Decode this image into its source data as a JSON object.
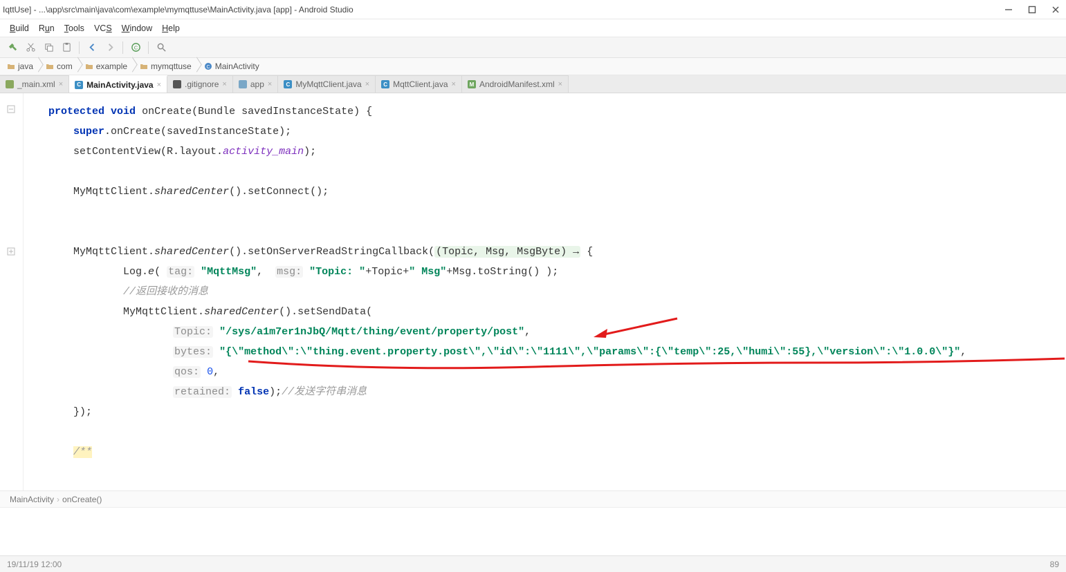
{
  "window": {
    "title": "IqttUse] - ...\\app\\src\\main\\java\\com\\example\\mymqttuse\\MainActivity.java [app] - Android Studio"
  },
  "menu": [
    "Build",
    "Run",
    "Tools",
    "VCS",
    "Window",
    "Help"
  ],
  "breadcrumbs": [
    {
      "icon": "folder",
      "label": "java"
    },
    {
      "icon": "folder",
      "label": "com"
    },
    {
      "icon": "folder",
      "label": "example"
    },
    {
      "icon": "folder",
      "label": "mymqttuse"
    },
    {
      "icon": "class",
      "label": "MainActivity"
    }
  ],
  "tabs": [
    {
      "icon": "xml",
      "label": "_main.xml",
      "active": false
    },
    {
      "icon": "java",
      "label": "MainActivity.java",
      "active": true
    },
    {
      "icon": "git",
      "label": ".gitignore",
      "active": false
    },
    {
      "icon": "grad",
      "label": "app",
      "active": false
    },
    {
      "icon": "java",
      "label": "MyMqttClient.java",
      "active": false
    },
    {
      "icon": "java",
      "label": "MqttClient.java",
      "active": false
    },
    {
      "icon": "mf",
      "label": "AndroidManifest.xml",
      "active": false
    }
  ],
  "code": {
    "sig_kw1": "protected",
    "sig_kw2": "void",
    "sig_mtd": "onCreate",
    "sig_args": "(Bundle savedInstanceState) {",
    "l2_pre": "super",
    "l2_rest": ".onCreate(savedInstanceState);",
    "l3_pre": "setContentView",
    "l3_mid": "(R.layout.",
    "l3_field": "activity_main",
    "l3_end": ");",
    "l5": "MyMqttClient.",
    "l5_it": "sharedCenter",
    "l5_end": "().setConnect();",
    "l8_pre": "MyMqttClient.",
    "l8_it": "sharedCenter",
    "l8_mid": "().setOnServerReadStringCallback(",
    "l8_lambda": "(Topic, Msg, MsgByte) →",
    "l8_end": " {",
    "l9_pre": "Log.",
    "l9_it": "e",
    "l9_open": "( ",
    "l9_h1": "tag:",
    "l9_s1": "\"MqttMsg\"",
    "l9_c1": ",  ",
    "l9_h2": "msg:",
    "l9_s2a": "\"Topic: \"",
    "l9_mid": "+Topic+",
    "l9_s2b": "\" Msg\"",
    "l9_end": "+Msg.toString() );",
    "l10_cmt": "//返回接收的消息",
    "l11_pre": "MyMqttClient.",
    "l11_it": "sharedCenter",
    "l11_end": "().setSendData(",
    "l12_h": "Topic:",
    "l12_s": "\"/sys/a1m7er1nJbQ/Mqtt/thing/event/property/post\"",
    "l12_end": ",",
    "l13_h": "bytes:",
    "l13_s": "\"{\\\"method\\\":\\\"thing.event.property.post\\\",\\\"id\\\":\\\"1111\\\",\\\"params\\\":{\\\"temp\\\":25,\\\"humi\\\":55},\\\"version\\\":\\\"1.0.0\\\"}\"",
    "l13_end": ",",
    "l14_h": "qos:",
    "l14_v": "0",
    "l14_end": ",",
    "l15_h": "retained:",
    "l15_v": "false",
    "l15_end": ");",
    "l15_cmt": "//发送字符串消息",
    "l16": "});",
    "l18": "/**"
  },
  "status_path": {
    "a": "MainActivity",
    "b": "onCreate()"
  },
  "bottom": {
    "left": "19/11/19 12:00",
    "right": "89"
  },
  "colors": {
    "keyword": "#0033b3",
    "string": "#00855a",
    "field": "#7d2fbd",
    "number": "#1750eb",
    "comment": "#9b9b9b",
    "annotation": "#e21b1b"
  }
}
